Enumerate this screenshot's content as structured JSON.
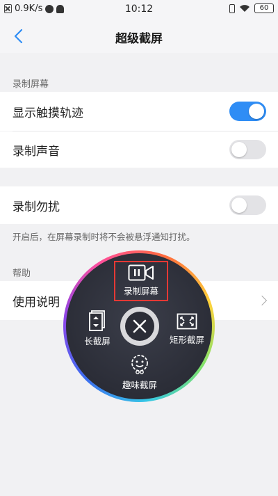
{
  "status_bar": {
    "net_speed": "0.9K/s",
    "time": "10:12",
    "battery": "60"
  },
  "nav": {
    "title": "超级截屏"
  },
  "sections": {
    "record_screen_header": "录制屏幕",
    "help_header": "帮助"
  },
  "settings": {
    "show_touch": {
      "label": "显示触摸轨迹",
      "enabled": true
    },
    "record_sound": {
      "label": "录制声音",
      "enabled": false
    },
    "dnd": {
      "label": "录制勿扰",
      "enabled": false
    },
    "dnd_desc": "开启后，在屏幕录制时将不会被悬浮通知打扰。",
    "manual": {
      "label": "使用说明"
    }
  },
  "float_menu": {
    "record": "录制屏幕",
    "long": "长截屏",
    "rect": "矩形截屏",
    "fun": "趣味截屏"
  },
  "colors": {
    "accent": "#2f8df5",
    "highlight": "#e53935"
  }
}
